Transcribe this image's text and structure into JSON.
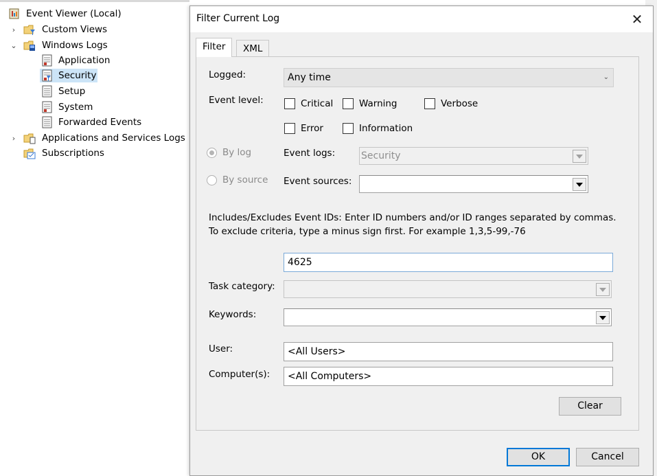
{
  "tree": {
    "items": [
      {
        "label": "Event Viewer (Local)",
        "icon": "event-viewer-icon"
      },
      {
        "label": "Custom Views",
        "icon": "folder-filter-icon"
      },
      {
        "label": "Windows Logs",
        "icon": "folder-logs-icon"
      },
      {
        "label": "Application",
        "icon": "log-icon"
      },
      {
        "label": "Security",
        "icon": "log-icon",
        "selected": true
      },
      {
        "label": "Setup",
        "icon": "log-icon"
      },
      {
        "label": "System",
        "icon": "log-icon"
      },
      {
        "label": "Forwarded Events",
        "icon": "log-icon"
      },
      {
        "label": "Applications and Services Logs",
        "icon": "folder-icon"
      },
      {
        "label": "Subscriptions",
        "icon": "subscriptions-icon"
      }
    ]
  },
  "dialog": {
    "title": "Filter Current Log",
    "close": "✕",
    "tabs": [
      "Filter",
      "XML"
    ],
    "logged_label": "Logged:",
    "logged_value": "Any time",
    "event_level_label": "Event level:",
    "levels": {
      "critical": "Critical",
      "warning": "Warning",
      "verbose": "Verbose",
      "error": "Error",
      "information": "Information"
    },
    "by_log": "By log",
    "by_source": "By source",
    "event_logs_label": "Event logs:",
    "event_logs_value": "Security",
    "event_sources_label": "Event sources:",
    "event_sources_value": "",
    "ids_help": "Includes/Excludes Event IDs: Enter ID numbers and/or ID ranges separated by commas. To exclude criteria, type a minus sign first. For example 1,3,5-99,-76",
    "ids_value": "4625",
    "task_category_label": "Task category:",
    "task_category_value": "",
    "keywords_label": "Keywords:",
    "keywords_value": "",
    "user_label": "User:",
    "user_value": "<All Users>",
    "computers_label": "Computer(s):",
    "computers_value": "<All Computers>",
    "clear": "Clear",
    "ok": "OK",
    "cancel": "Cancel"
  },
  "colors": {
    "selection": "#cce4f7",
    "accent": "#0078d7",
    "dialog_bg": "#f0f0f0"
  }
}
